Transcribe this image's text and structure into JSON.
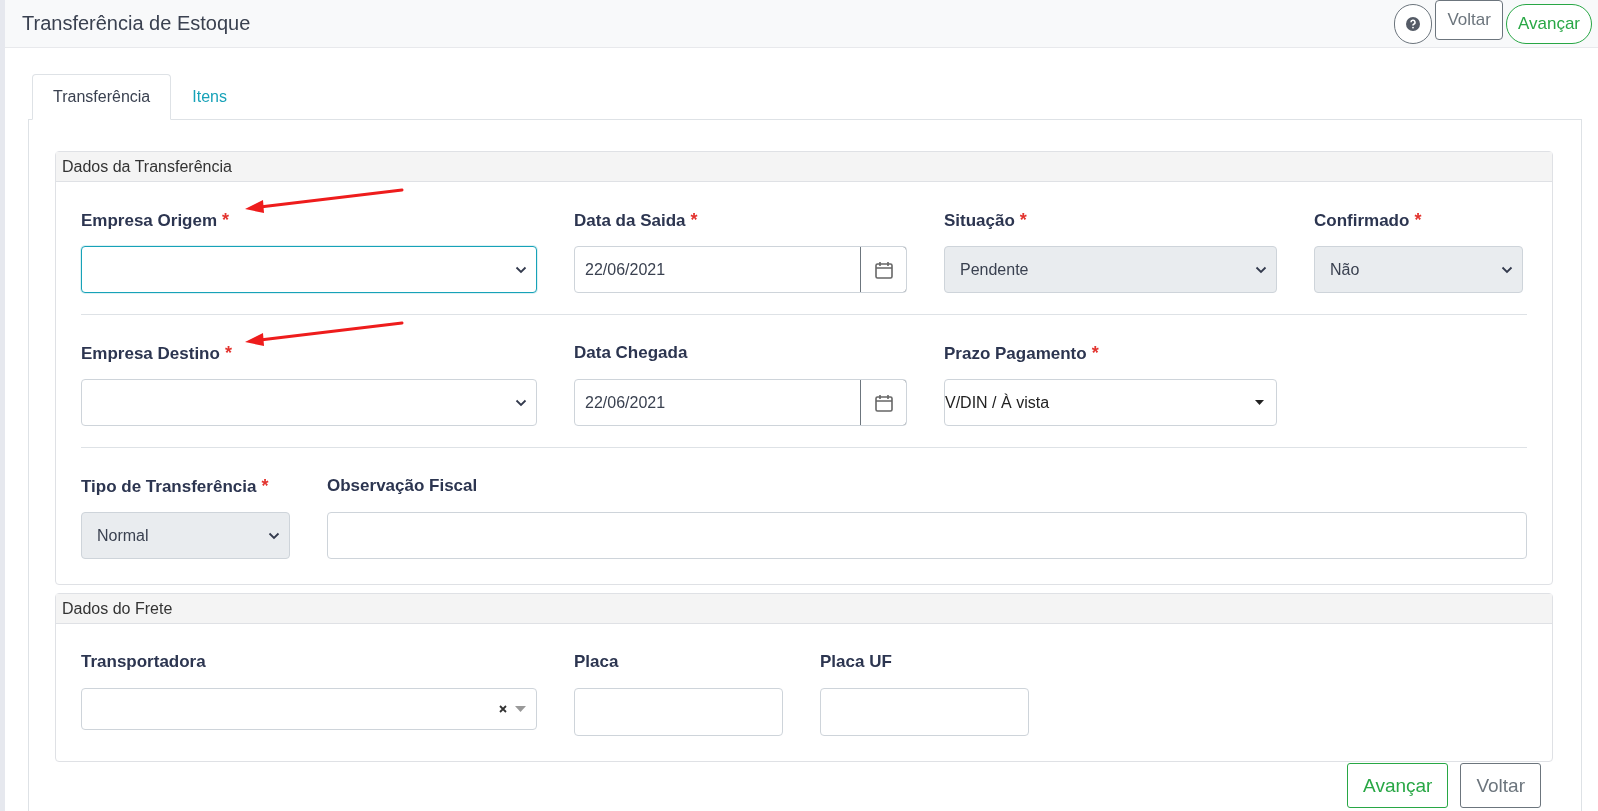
{
  "header": {
    "title": "Transferência de Estoque",
    "buttons": [
      {
        "label": "Voltar",
        "kind": "secondary"
      },
      {
        "label": "Avançar",
        "kind": "success"
      }
    ]
  },
  "tabs": [
    {
      "label": "Transferência",
      "selected": true
    },
    {
      "label": "Itens",
      "selected": false
    }
  ],
  "sections": [
    {
      "title": "Dados da Transferência",
      "rows": [
        {
          "fields": [
            {
              "label": "Empresa Origem",
              "required_mark": "*",
              "kind": "select",
              "focused": true,
              "disabled": false,
              "annotated": true
            },
            {
              "label": "Data da Saida",
              "required_mark": "*",
              "kind": "date",
              "value": "22/06/2021",
              "annotated": false
            },
            {
              "label": "Situação",
              "required_mark": "*",
              "kind": "select",
              "value": "Pendente",
              "focused": false,
              "disabled": true,
              "annotated": false
            },
            {
              "label": "Confirmado",
              "required_mark": "*",
              "kind": "select",
              "value": "Não",
              "focused": false,
              "disabled": true,
              "annotated": false
            }
          ]
        },
        {
          "fields": [
            {
              "label": "Empresa Destino",
              "required_mark": "*",
              "kind": "select",
              "focused": false,
              "disabled": false,
              "annotated": true
            },
            {
              "label": "Data Chegada",
              "kind": "date",
              "value": "22/06/2021",
              "annotated": false
            },
            {
              "label": "Prazo Pagamento",
              "required_mark": "*",
              "kind": "dropdown",
              "value": "V/DIN / À vista",
              "annotated": false
            }
          ]
        },
        {
          "fields": [
            {
              "label": "Tipo de Transferência",
              "required_mark": "*",
              "kind": "select",
              "value": "Normal",
              "focused": false,
              "disabled": true,
              "annotated": false
            },
            {
              "label": "Observação Fiscal",
              "kind": "text",
              "annotated": false
            }
          ]
        }
      ]
    },
    {
      "title": "Dados do Frete",
      "rows": [
        {
          "fields": [
            {
              "label": "Transportadora",
              "kind": "combo",
              "annotated": false
            },
            {
              "label": "Placa",
              "kind": "text",
              "annotated": false
            },
            {
              "label": "Placa UF",
              "kind": "text",
              "annotated": false
            }
          ]
        }
      ]
    }
  ],
  "footer_buttons": [
    {
      "label": "Avançar",
      "kind": "success"
    },
    {
      "label": "Voltar",
      "kind": "secondary"
    }
  ]
}
